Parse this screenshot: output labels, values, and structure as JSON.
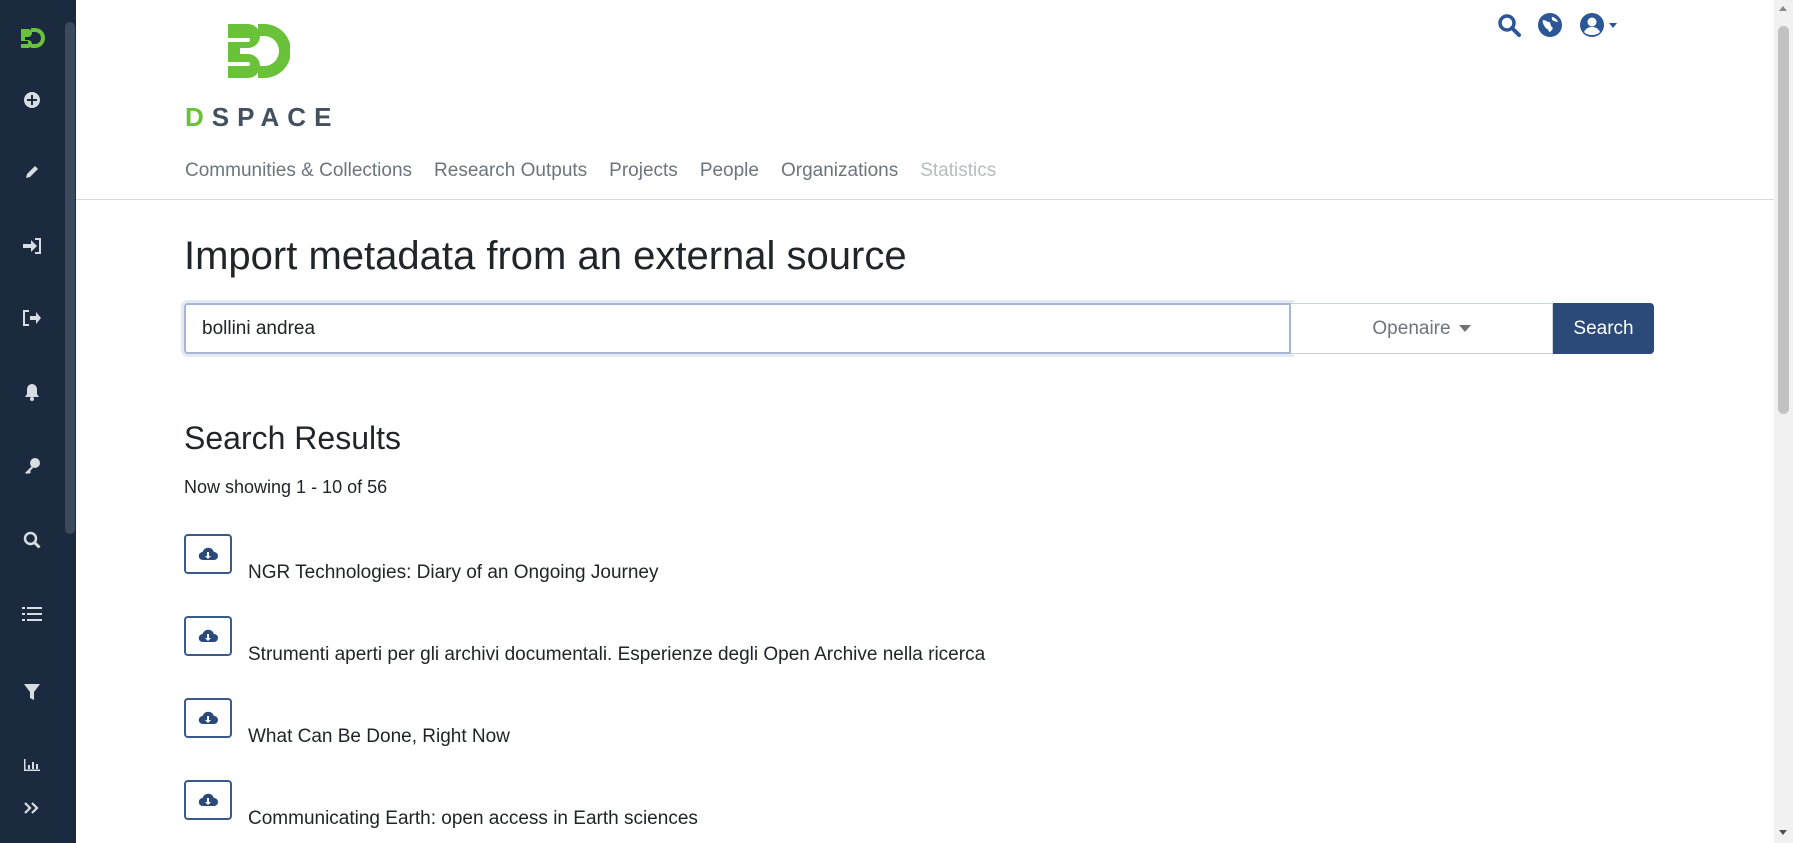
{
  "brand": {
    "logo_letter": "D",
    "logo_rest": "SPACE",
    "accent_color": "#6ac23a",
    "primary_color": "#2b4a7a"
  },
  "sidebar": {
    "items": [
      {
        "icon": "dspace-logo-icon"
      },
      {
        "icon": "plus-circle-icon"
      },
      {
        "icon": "pencil-icon"
      },
      {
        "icon": "sign-in-icon"
      },
      {
        "icon": "sign-out-icon"
      },
      {
        "icon": "bell-icon"
      },
      {
        "icon": "key-icon"
      },
      {
        "icon": "search-icon"
      },
      {
        "icon": "list-icon"
      },
      {
        "icon": "filter-icon"
      },
      {
        "icon": "bar-chart-icon"
      },
      {
        "icon": "double-chevron-right-icon"
      }
    ]
  },
  "header": {
    "icons": [
      "search-icon",
      "globe-icon",
      "user-icon"
    ],
    "nav": [
      {
        "label": "Communities & Collections",
        "disabled": false
      },
      {
        "label": "Research Outputs",
        "disabled": false
      },
      {
        "label": "Projects",
        "disabled": false
      },
      {
        "label": "People",
        "disabled": false
      },
      {
        "label": "Organizations",
        "disabled": false
      },
      {
        "label": "Statistics",
        "disabled": true
      }
    ]
  },
  "main": {
    "title": "Import metadata from an external source",
    "search": {
      "value": "bollini andrea",
      "source": "Openaire",
      "button_label": "Search"
    },
    "results_title": "Search Results",
    "results_count": "Now showing 1 - 10 of 56",
    "results": [
      {
        "title": "NGR Technologies: Diary of an Ongoing Journey"
      },
      {
        "title": "Strumenti aperti per gli archivi documentali. Esperienze degli Open Archive nella ricerca"
      },
      {
        "title": "What Can Be Done, Right Now"
      },
      {
        "title": "Communicating Earth: open access in Earth sciences"
      }
    ]
  }
}
